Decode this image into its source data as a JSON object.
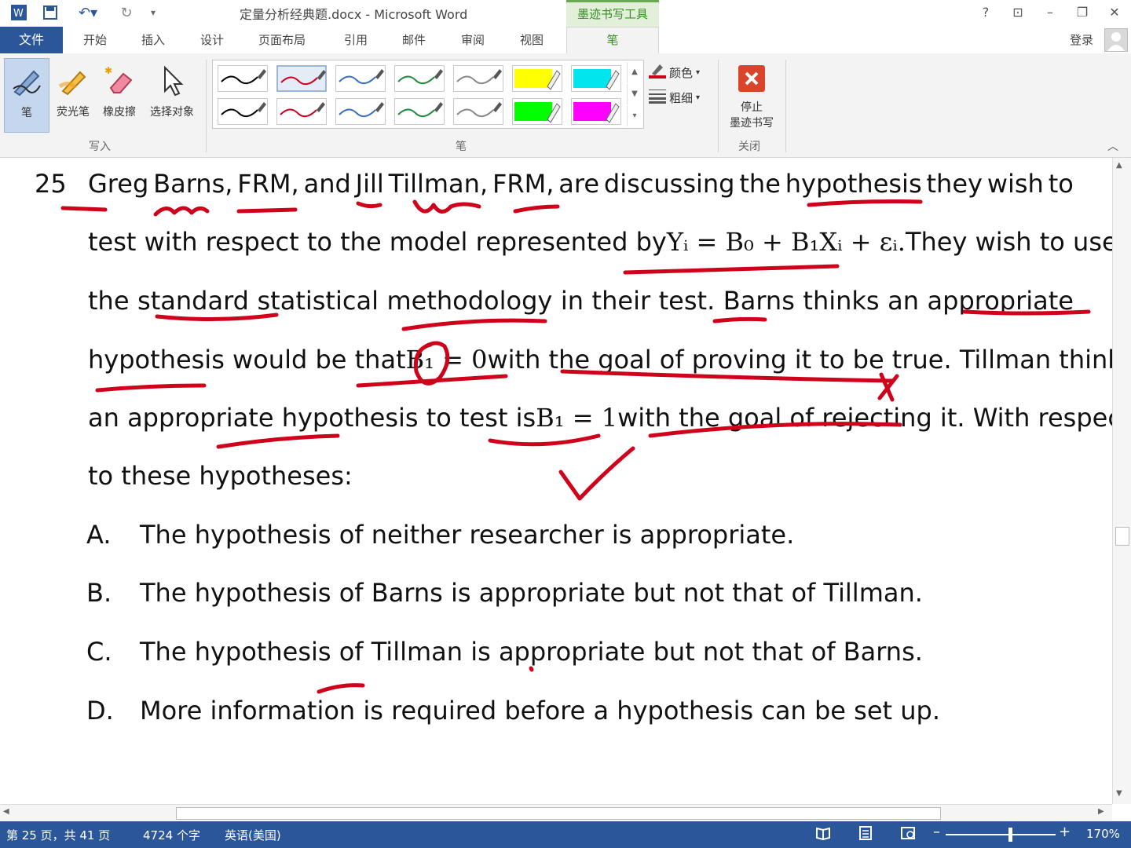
{
  "titlebar": {
    "title": "定量分析经典题.docx - Microsoft Word",
    "contextual_tab": "墨迹书写工具",
    "help": "?",
    "restore_ribbon": "⊡",
    "minimize": "–",
    "maximize": "❐",
    "close": "✕"
  },
  "tabs": {
    "file": "文件",
    "items": [
      "开始",
      "插入",
      "设计",
      "页面布局",
      "引用",
      "邮件",
      "审阅",
      "视图"
    ],
    "pen": "笔",
    "signin": "登录"
  },
  "ribbon": {
    "write_group": {
      "label": "写入",
      "pen": "笔",
      "highlighter": "荧光笔",
      "eraser": "橡皮擦",
      "select": "选择对象"
    },
    "pens_group": {
      "label": "笔",
      "color": "颜色",
      "thickness": "粗细",
      "pen_colors": [
        "#000000",
        "#d0001a",
        "#3a6fbf",
        "#1f8a3a",
        "#888888",
        "#ffff00",
        "#00e5ee",
        "#00ff00",
        "#ff00ff"
      ]
    },
    "close_group": {
      "label": "关闭",
      "stop_line1": "停止",
      "stop_line2": "墨迹书写"
    }
  },
  "document": {
    "question_number": "25",
    "lines": [
      [
        "Greg",
        "Barns,",
        "FRM,",
        "and",
        "Jill",
        "Tillman,",
        "FRM,",
        "are",
        "discussing",
        "the",
        "hypothesis",
        "they",
        "wish",
        "to"
      ],
      {
        "pre": "test with respect to the model represented by",
        "eq": "Yᵢ = B₀ + B₁Xᵢ + εᵢ.",
        "post": "They wish to use"
      },
      [
        "the",
        "standard",
        "statistical",
        "methodology",
        "in",
        "their",
        "test.",
        "Barns",
        "thinks",
        "an",
        "appropriate"
      ],
      {
        "pre": "hypothesis would be that",
        "eq": "B₁ = 0",
        "post": "with the goal of proving it to be true. Tillman thinks"
      },
      {
        "pre": "an appropriate hypothesis to test is",
        "eq": "B₁ = 1",
        "post": "with the goal of rejecting it. With respect"
      },
      "to these hypotheses:"
    ],
    "options": [
      {
        "letter": "A.",
        "text": "The hypothesis of neither researcher is appropriate."
      },
      {
        "letter": "B.",
        "text": "The hypothesis of Barns is appropriate but not that of Tillman."
      },
      {
        "letter": "C.",
        "text": "The hypothesis of Tillman is appropriate but not that of Barns."
      },
      {
        "letter": "D.",
        "text": "More information is required before a hypothesis can be set up."
      }
    ],
    "ink_color": "#d0021b"
  },
  "statusbar": {
    "page": "第 25 页，共 41 页",
    "words": "4724 个字",
    "language": "英语(美国)",
    "zoom": "170%"
  }
}
